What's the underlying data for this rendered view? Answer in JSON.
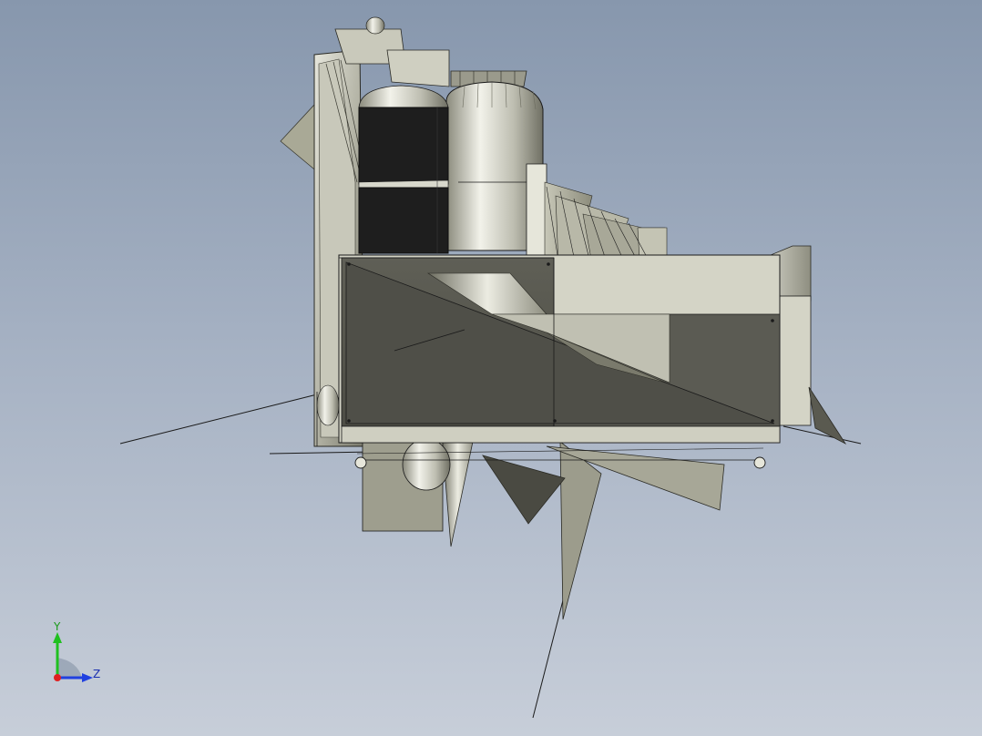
{
  "viewport": {
    "background_top": "#8797ad",
    "background_bottom": "#c7ced9"
  },
  "model": {
    "name": "",
    "colors": {
      "metal_light": "#d2d2c4",
      "metal_mid": "#a8a898",
      "metal_dark": "#5a5a52",
      "panel_dark": "#58584f",
      "black": "#1c1c1c",
      "edge": "#1a1a1a"
    }
  },
  "triad": {
    "y_label": "Y",
    "z_label": "Z",
    "x_color": "#e02020",
    "y_color": "#20c020",
    "z_color": "#2040e0"
  }
}
